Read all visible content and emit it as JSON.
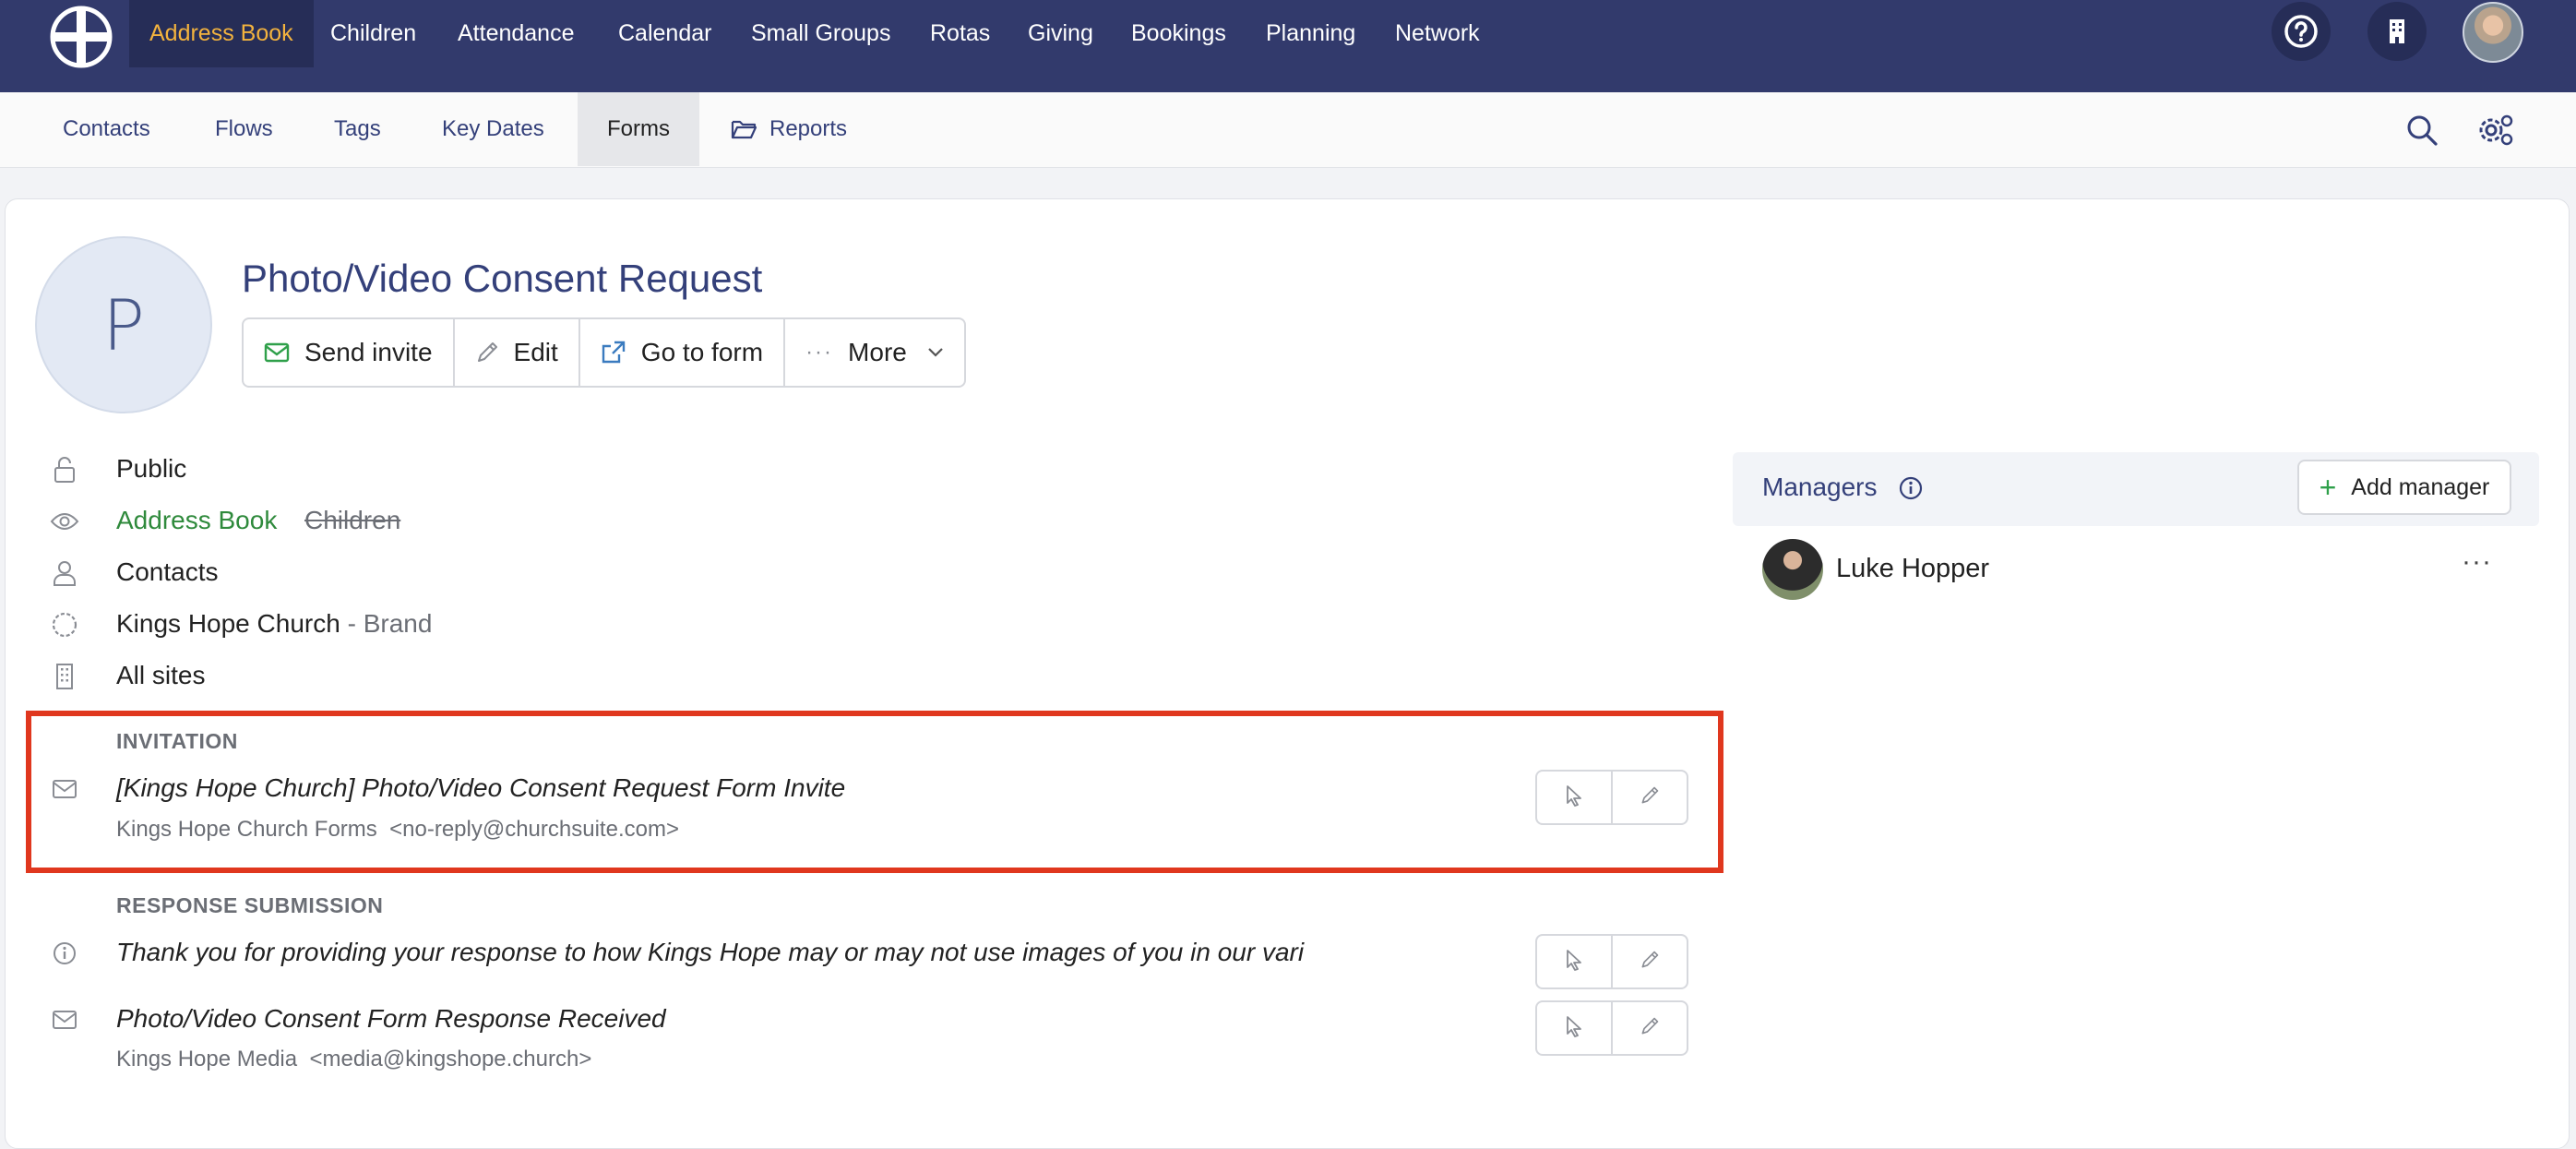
{
  "topnav": {
    "items": [
      "Address Book",
      "Children",
      "Attendance",
      "Calendar",
      "Small Groups",
      "Rotas",
      "Giving",
      "Bookings",
      "Planning",
      "Network"
    ],
    "icons": [
      "help-icon",
      "building-icon",
      "user-avatar"
    ]
  },
  "subnav": {
    "items": [
      "Contacts",
      "Flows",
      "Tags",
      "Key Dates",
      "Forms",
      "Reports"
    ],
    "icons": [
      "search-icon",
      "settings-icon"
    ]
  },
  "form": {
    "avatar_letter": "P",
    "title": "Photo/Video Consent Request",
    "actions": {
      "send_invite": "Send invite",
      "edit": "Edit",
      "go_to_form": "Go to form",
      "more": "More"
    }
  },
  "properties": {
    "visibility": "Public",
    "module_active": "Address Book",
    "module_inactive": "Children",
    "type": "Contacts",
    "brand_name": "Kings Hope Church",
    "brand_suffix": " - Brand",
    "sites": "All sites"
  },
  "invitation": {
    "label": "INVITATION",
    "subject": "[Kings Hope Church] Photo/Video Consent Request Form Invite",
    "from_name": "Kings Hope Church Forms",
    "from_email": "<no-reply@churchsuite.com>"
  },
  "response": {
    "label": "RESPONSE SUBMISSION",
    "message": "Thank you for providing your response to how Kings Hope may or may not use images of you in our vari",
    "email_subject": "Photo/Video Consent Form Response Received",
    "from_name": "Kings Hope Media",
    "from_email": "<media@kingshope.church>"
  },
  "managers": {
    "title": "Managers",
    "add_label": "Add manager",
    "list": [
      {
        "name": "Luke Hopper"
      }
    ],
    "more": "···"
  },
  "colors": {
    "nav_bg": "#323a6c",
    "nav_active_text": "#f3b33e",
    "link_blue": "#34407a",
    "green": "#2fa04a",
    "highlight_red": "#e0371e"
  }
}
